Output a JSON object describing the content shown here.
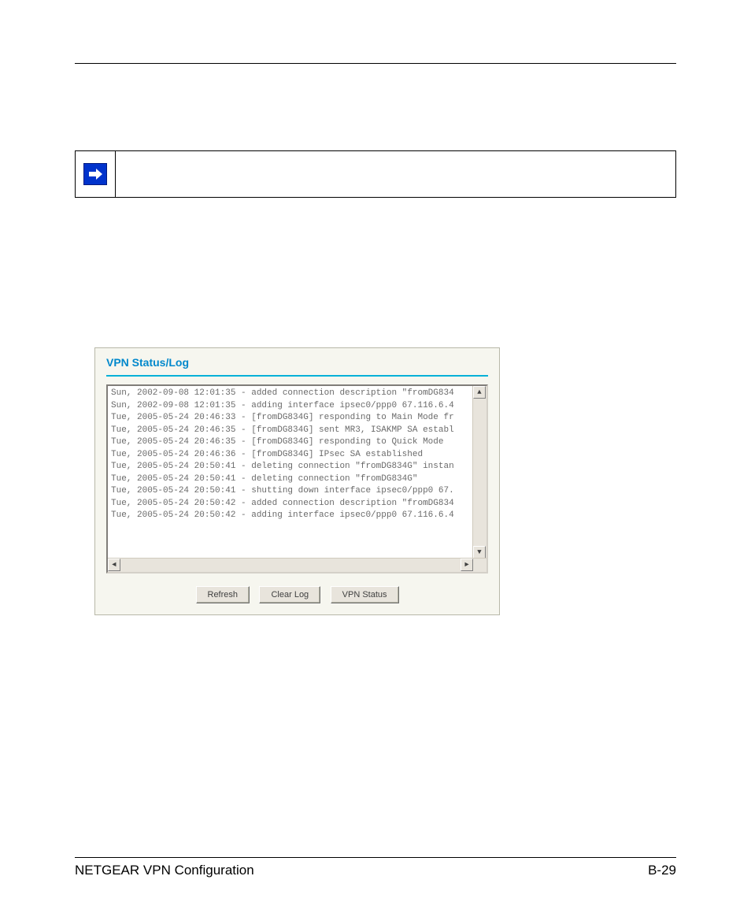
{
  "panel": {
    "title": "VPN Status/Log"
  },
  "log": {
    "lines": [
      "Sun, 2002-09-08 12:01:35 - added connection description \"fromDG834",
      "Sun, 2002-09-08 12:01:35 - adding interface ipsec0/ppp0 67.116.6.4",
      "Tue, 2005-05-24 20:46:33 - [fromDG834G] responding to Main Mode fr",
      "Tue, 2005-05-24 20:46:35 - [fromDG834G] sent MR3, ISAKMP SA establ",
      "Tue, 2005-05-24 20:46:35 - [fromDG834G] responding to Quick Mode",
      "Tue, 2005-05-24 20:46:36 - [fromDG834G] IPsec SA established",
      "Tue, 2005-05-24 20:50:41 - deleting connection \"fromDG834G\" instan",
      "Tue, 2005-05-24 20:50:41 - deleting connection \"fromDG834G\"",
      "Tue, 2005-05-24 20:50:41 - shutting down interface ipsec0/ppp0 67.",
      "Tue, 2005-05-24 20:50:42 - added connection description \"fromDG834",
      "Tue, 2005-05-24 20:50:42 - adding interface ipsec0/ppp0 67.116.6.4"
    ]
  },
  "buttons": {
    "refresh": "Refresh",
    "clear": "Clear Log",
    "status": "VPN Status"
  },
  "footer": {
    "left": "NETGEAR VPN Configuration",
    "right": "B-29"
  }
}
